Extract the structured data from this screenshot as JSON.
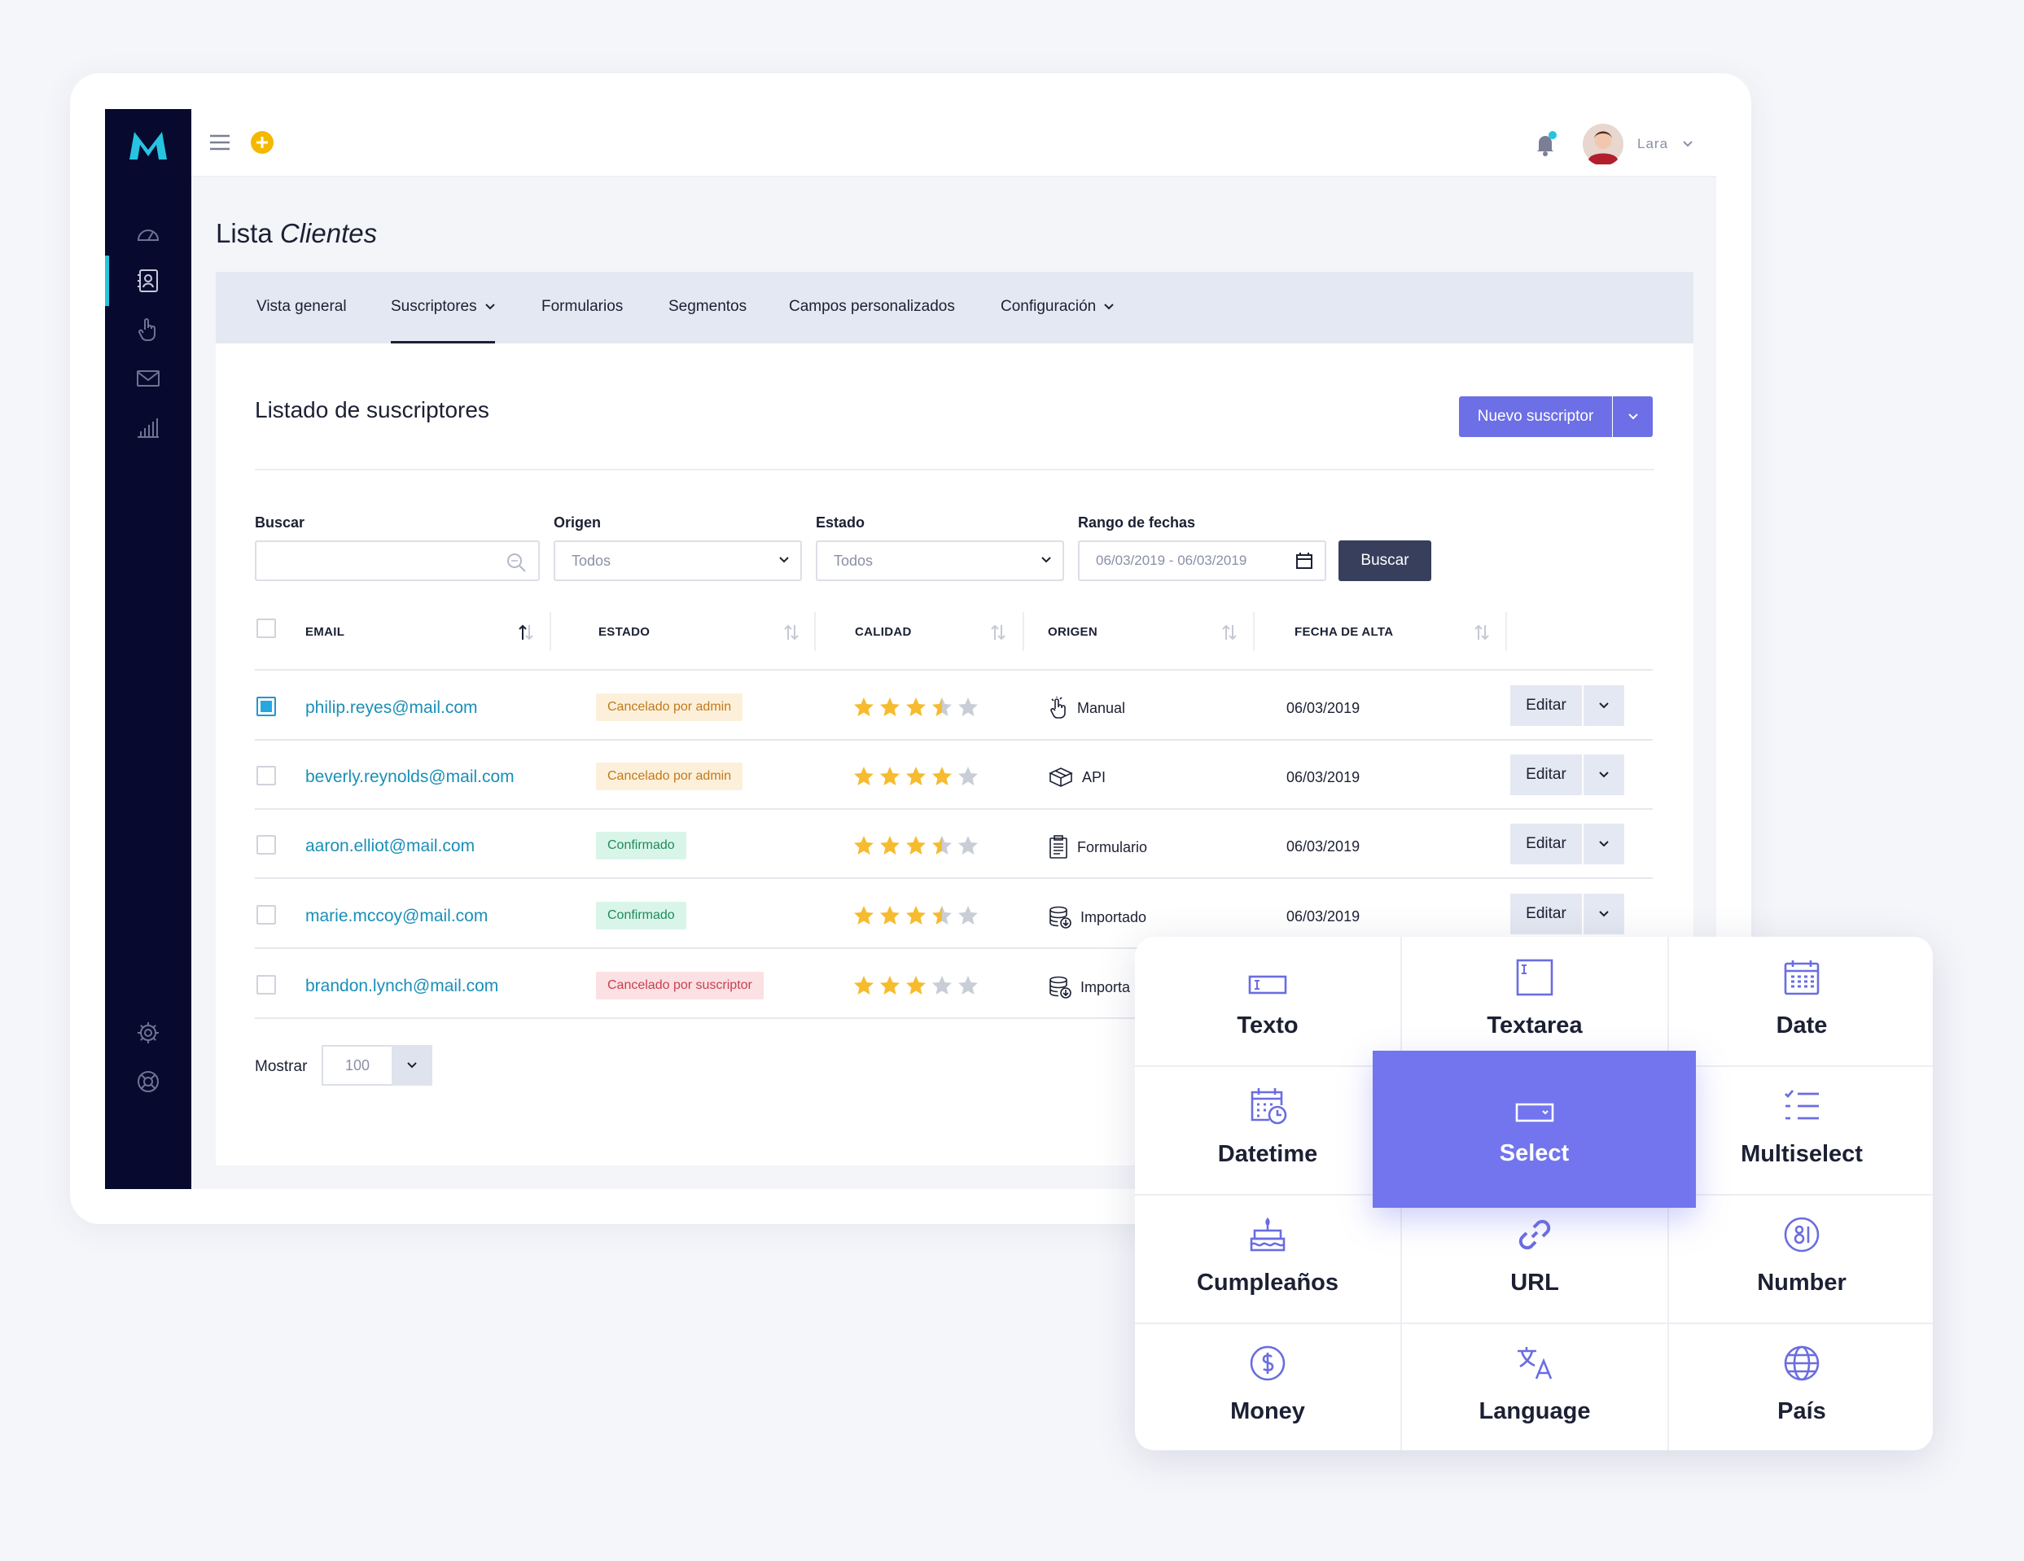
{
  "app": {
    "page_title_prefix": "Lista",
    "page_title_italic": "Clientes"
  },
  "topbar": {
    "username": "Lara",
    "notification_dot_color": "#25c4e0",
    "add_button_color": "#f5b800"
  },
  "sidebar": {
    "items": [
      {
        "icon": "dashboard-gauge-icon",
        "active": false
      },
      {
        "icon": "contacts-book-icon",
        "active": true
      },
      {
        "icon": "hand-pointer-icon",
        "active": false
      },
      {
        "icon": "envelope-icon",
        "active": false
      },
      {
        "icon": "bar-chart-icon",
        "active": false
      }
    ],
    "bottom_items": [
      {
        "icon": "gear-icon"
      },
      {
        "icon": "help-lifebuoy-icon"
      }
    ]
  },
  "tabs": [
    {
      "label": "Vista general",
      "active": false,
      "dropdown": false
    },
    {
      "label": "Suscriptores",
      "active": true,
      "dropdown": true
    },
    {
      "label": "Formularios",
      "active": false,
      "dropdown": false
    },
    {
      "label": "Segmentos",
      "active": false,
      "dropdown": false
    },
    {
      "label": "Campos personalizados",
      "active": false,
      "dropdown": false
    },
    {
      "label": "Configuración",
      "active": false,
      "dropdown": true
    }
  ],
  "section": {
    "title": "Listado de suscriptores",
    "new_button_label": "Nuevo suscriptor"
  },
  "filters": {
    "search": {
      "label": "Buscar",
      "value": ""
    },
    "origin": {
      "label": "Origen",
      "value": "Todos"
    },
    "status": {
      "label": "Estado",
      "value": "Todos"
    },
    "date_range": {
      "label": "Rango de fechas",
      "value": "06/03/2019 - 06/03/2019"
    },
    "submit_label": "Buscar"
  },
  "table": {
    "columns": [
      "EMAIL",
      "ESTADO",
      "CALIDAD",
      "ORIGEN",
      "FECHA DE ALTA"
    ],
    "rows": [
      {
        "checked": true,
        "email": "philip.reyes@mail.com",
        "status": "Cancelado por admin",
        "status_kind": "orange",
        "rating": 3.5,
        "origin": "Manual",
        "origin_icon": "pointer-hand-icon",
        "date": "06/03/2019",
        "action": "Editar"
      },
      {
        "checked": false,
        "email": "beverly.reynolds@mail.com",
        "status": "Cancelado por admin",
        "status_kind": "orange",
        "rating": 4,
        "origin": "API",
        "origin_icon": "cube-api-icon",
        "date": "06/03/2019",
        "action": "Editar"
      },
      {
        "checked": false,
        "email": "aaron.elliot@mail.com",
        "status": "Confirmado",
        "status_kind": "green",
        "rating": 3.5,
        "origin": "Formulario",
        "origin_icon": "clipboard-form-icon",
        "date": "06/03/2019",
        "action": "Editar"
      },
      {
        "checked": false,
        "email": "marie.mccoy@mail.com",
        "status": "Confirmado",
        "status_kind": "green",
        "rating": 3.5,
        "origin": "Importado",
        "origin_icon": "database-import-icon",
        "date": "06/03/2019",
        "action": "Editar"
      },
      {
        "checked": false,
        "email": "brandon.lynch@mail.com",
        "status": "Cancelado por suscriptor",
        "status_kind": "red",
        "rating": 3,
        "origin": "Importa",
        "origin_icon": "database-import-icon",
        "date": "",
        "action": ""
      }
    ]
  },
  "pagination": {
    "show_label": "Mostrar",
    "page_size": "100"
  },
  "field_picker": {
    "accent": "#7275ee",
    "fields": [
      {
        "label": "Texto",
        "icon": "text-field-icon",
        "selected": false
      },
      {
        "label": "Textarea",
        "icon": "textarea-icon",
        "selected": false
      },
      {
        "label": "Date",
        "icon": "calendar-icon",
        "selected": false
      },
      {
        "label": "Datetime",
        "icon": "calendar-clock-icon",
        "selected": false
      },
      {
        "label": "Select",
        "icon": "select-dropdown-icon",
        "selected": true
      },
      {
        "label": "Multiselect",
        "icon": "checklist-icon",
        "selected": false
      },
      {
        "label": "Cumpleaños",
        "icon": "birthday-cake-icon",
        "selected": false
      },
      {
        "label": "URL",
        "icon": "link-icon",
        "selected": false
      },
      {
        "label": "Number",
        "icon": "number-icon",
        "selected": false
      },
      {
        "label": "Money",
        "icon": "dollar-coin-icon",
        "selected": false
      },
      {
        "label": "Language",
        "icon": "translate-icon",
        "selected": false
      },
      {
        "label": "País",
        "icon": "globe-icon",
        "selected": false
      }
    ]
  }
}
